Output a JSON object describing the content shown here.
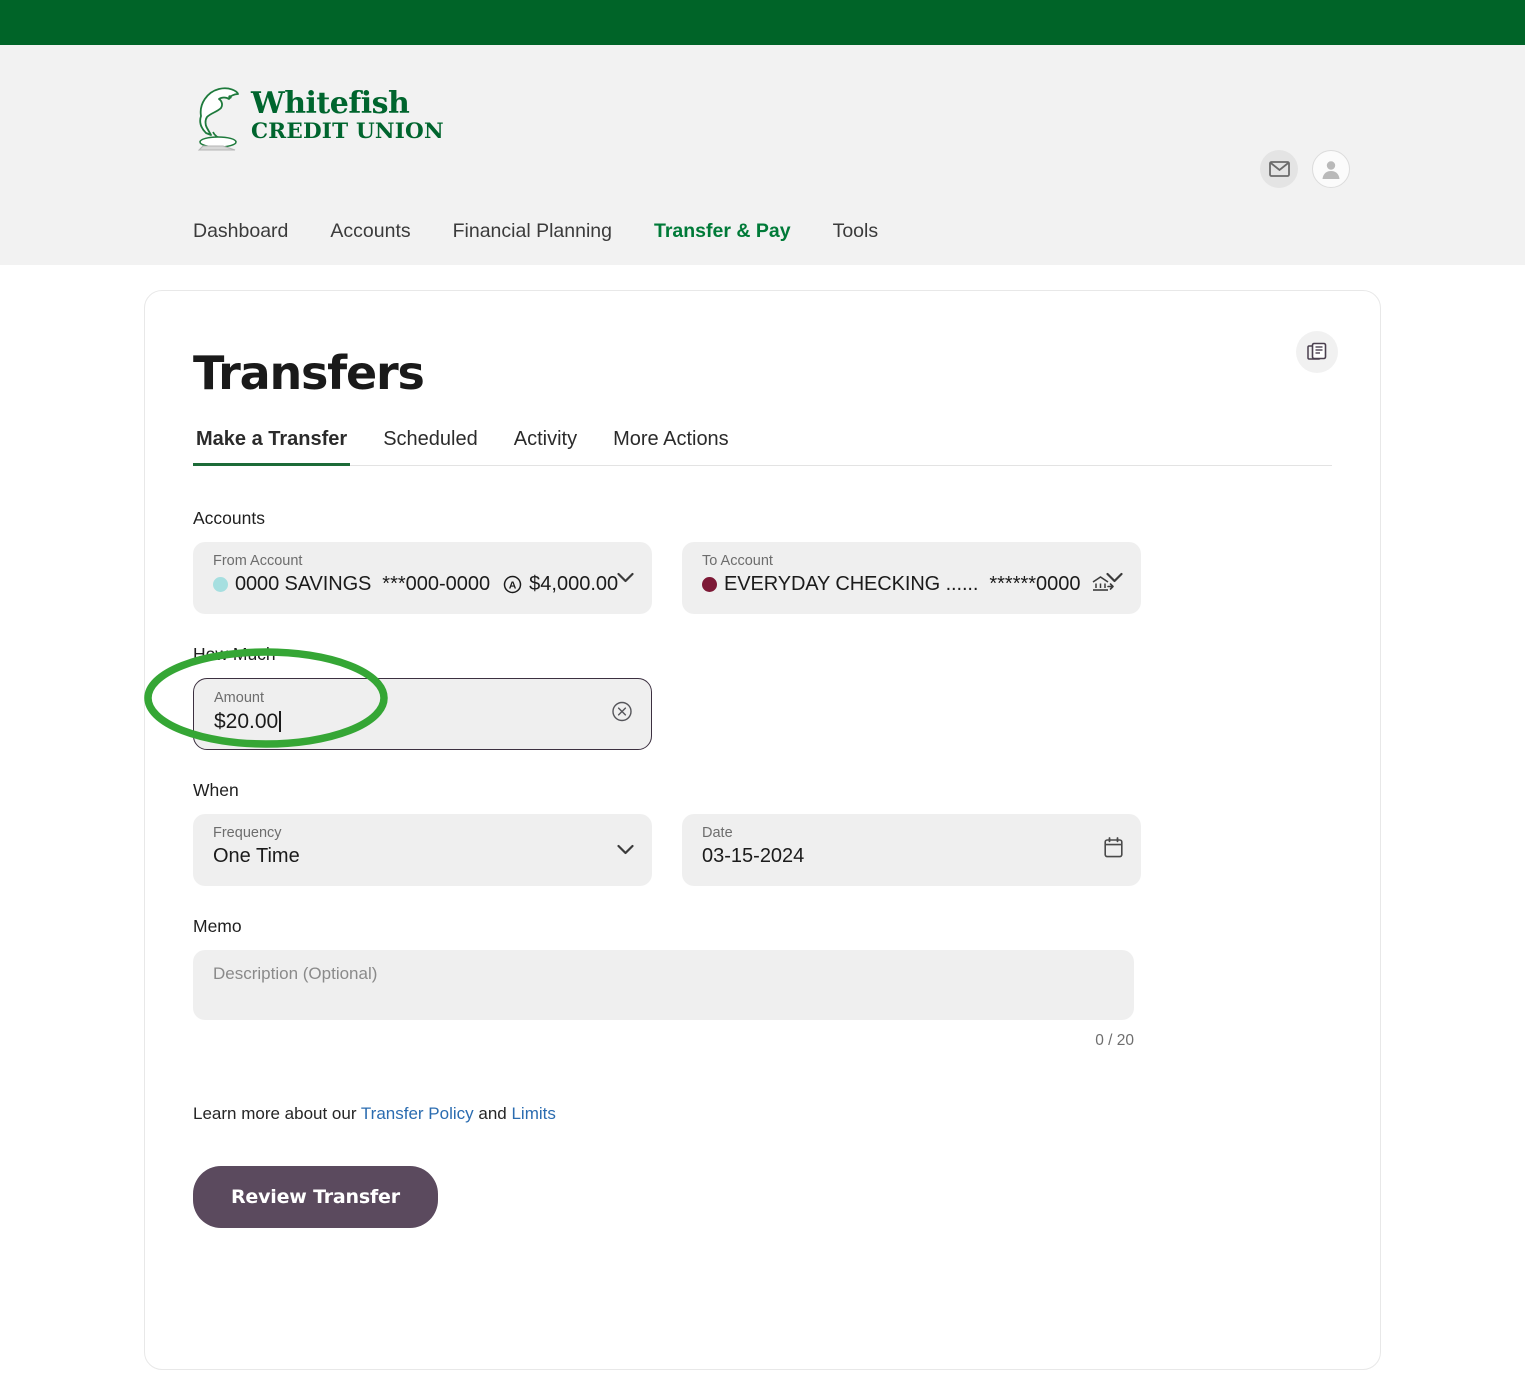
{
  "brand": {
    "name_line1": "Whitefish",
    "name_line2": "CREDIT UNION",
    "green": "#006428"
  },
  "header": {
    "mail_icon": "mail-icon",
    "avatar_icon": "user-avatar-icon",
    "nav": [
      {
        "label": "Dashboard",
        "active": false
      },
      {
        "label": "Accounts",
        "active": false
      },
      {
        "label": "Financial Planning",
        "active": false
      },
      {
        "label": "Transfer & Pay",
        "active": true
      },
      {
        "label": "Tools",
        "active": false
      }
    ]
  },
  "page": {
    "title": "Transfers",
    "statements_icon": "documents-icon",
    "tabs": [
      {
        "label": "Make a Transfer",
        "active": true
      },
      {
        "label": "Scheduled",
        "active": false
      },
      {
        "label": "Activity",
        "active": false
      },
      {
        "label": "More Actions",
        "active": false
      }
    ]
  },
  "accounts_section": {
    "label": "Accounts",
    "from": {
      "field_label": "From Account",
      "dot_color": "#a6dfe0",
      "name": "0000 SAVINGS",
      "number": "***000-0000",
      "badge_icon": "circled-a-icon",
      "balance": "$4,000.00"
    },
    "to": {
      "field_label": "To Account",
      "dot_color": "#7d1936",
      "name": "EVERYDAY CHECKING ......",
      "number": "******0000",
      "badge_icon": "bank-transfer-icon"
    }
  },
  "amount_section": {
    "label": "How Much",
    "field_label": "Amount",
    "value": "$20.00",
    "clear_icon": "clear-circle-icon",
    "annotation_color": "#35a635"
  },
  "when_section": {
    "label": "When",
    "frequency": {
      "field_label": "Frequency",
      "value": "One Time"
    },
    "date": {
      "field_label": "Date",
      "value": "03-15-2024",
      "icon": "calendar-icon"
    }
  },
  "memo_section": {
    "label": "Memo",
    "placeholder": "Description (Optional)",
    "counter": "0 / 20"
  },
  "footer": {
    "policy_prefix": "Learn more about our ",
    "policy_link": "Transfer Policy",
    "policy_mid": " and ",
    "limits_link": "Limits",
    "submit_label": "Review Transfer"
  }
}
